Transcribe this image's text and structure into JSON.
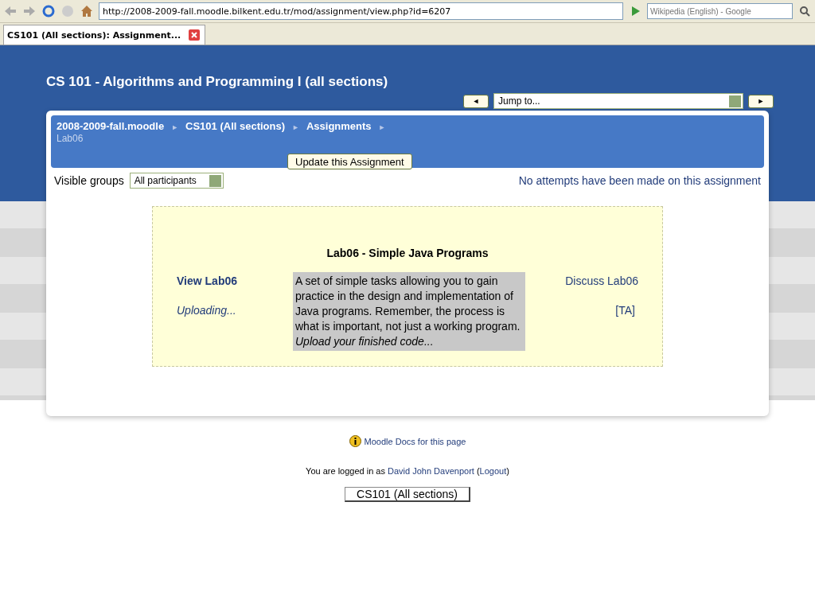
{
  "browser": {
    "url": "http://2008-2009-fall.moodle.bilkent.edu.tr/mod/assignment/view.php?id=6207",
    "search_placeholder": "Wikipedia (English) - Google",
    "tabs": [
      {
        "label": "CS101 (All sections): Assignment...",
        "selected": true
      }
    ]
  },
  "course_title": "CS 101 - Algorithms and Programming I (all sections)",
  "nav": {
    "prev": "◄",
    "jump": "Jump to...",
    "next": "►"
  },
  "breadcrumb": [
    {
      "label": "2008-2009-fall.moodle",
      "sep": "►"
    },
    {
      "label": "CS101 (All sections)",
      "sep": "►"
    },
    {
      "label": "Assignments",
      "sep": "►"
    }
  ],
  "current": "Lab06",
  "update_button": "Update this Assignment",
  "groups": {
    "label": "Visible groups",
    "value": "All participants"
  },
  "attempts_link": "No attempts have been made on this assignment",
  "assignment": {
    "title": "Lab06 - Simple Java Programs",
    "view_link": "View Lab06",
    "status": "Uploading...",
    "description": "A set of simple tasks allowing you to gain practice in the design and implementation of Java programs. Remember, the process is what is important, not just a working program.",
    "upload_note": "Upload your finished code...",
    "discuss_link": "Discuss Lab06",
    "ta": "[TA]"
  },
  "docs_link": "Moodle Docs for this page",
  "login": [
    {
      "kind": "text",
      "text": "You are logged in as "
    },
    {
      "kind": "link",
      "text": "David John Davenport"
    },
    {
      "kind": "text",
      "text": " ("
    },
    {
      "kind": "link",
      "text": "Logout"
    },
    {
      "kind": "text",
      "text": ")"
    }
  ],
  "course_button": "CS101 (All sections)"
}
